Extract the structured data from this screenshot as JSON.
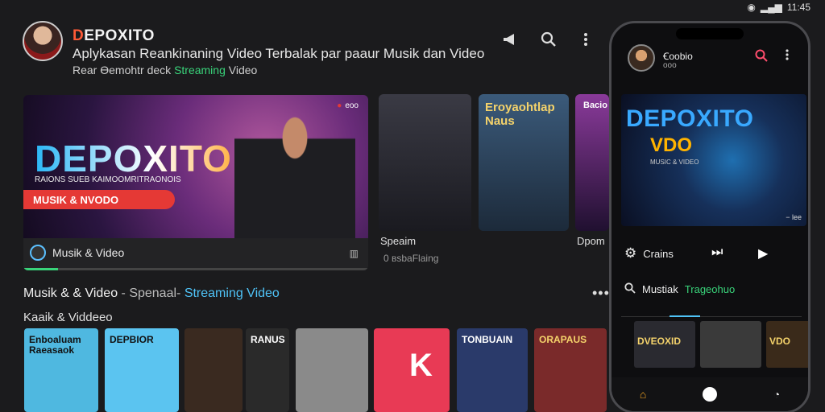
{
  "status_bar": {
    "time": "11:45",
    "signal": "▂▄▆",
    "wifi": "wifi-icon"
  },
  "header": {
    "app_name_accent": "D",
    "app_name_rest": "EPOXITO",
    "description": "Aplykasan Reankinaning Video Terbalak par paaur Musik dan Video",
    "sub_prefix": "Rear Ɵemohtr deck",
    "sub_highlight": "Streaming",
    "sub_suffix": "Video"
  },
  "hero": {
    "title": "DEPOXITO",
    "tagline": "RAIONS SUEB KAIMOOMRITRAONOIS",
    "button": "MUSIK & NVODO",
    "live_label": "eoo",
    "footer_label": "Musik & Video"
  },
  "thumbs": [
    {
      "title": "",
      "caption": "Speaim",
      "sub": "0 ʙsbaFlaing"
    },
    {
      "title": "Eroyaohtlap Naus",
      "caption": "",
      "sub": ""
    },
    {
      "title": "Bacio",
      "caption": "Dpom",
      "sub": ""
    }
  ],
  "section": {
    "title_part1": "Musik & & Video",
    "title_part2": " - Spenaal- ",
    "title_part3": "Streaming Video",
    "more": "•••",
    "subtitle": "Kaaik & Viddeeo"
  },
  "tiles": [
    {
      "label": "Enboaluam Raeasaok",
      "color": "#4fb8e0",
      "text_color": "#111"
    },
    {
      "label": "DEPBIOR",
      "color": "#5bc4f0",
      "text_color": "#111"
    },
    {
      "label": "",
      "color": "#3a2a20",
      "text_color": "#fff"
    },
    {
      "label": "RANUS",
      "color": "#2a2a2a",
      "text_color": "#fff"
    },
    {
      "label": "",
      "color": "#8a8a8a",
      "text_color": "#fff"
    },
    {
      "label": "K",
      "color": "#e83a55",
      "text_color": "#fff"
    },
    {
      "label": "TONBUAIN",
      "color": "#2a3a6a",
      "text_color": "#fff"
    },
    {
      "label": "ORAPAUS",
      "color": "#7a2a2a",
      "text_color": "#f5d36b"
    }
  ],
  "phone": {
    "profile_name": "Ꞓoobio",
    "profile_sub": "ooo",
    "banner_title": "DEPOXITO",
    "banner_vdo": "VDO",
    "banner_tag": "MUSIC & VIDEO",
    "banner_foot": "− lee",
    "settings_label": "Crains",
    "search_label": "Mustiak",
    "search_highlight": "Trageohuo",
    "tiles": [
      {
        "label": "DVEOXID",
        "color": "#2a2a30",
        "text_color": "#f5d36b"
      },
      {
        "label": "",
        "color": "#3a3a3a",
        "text_color": "#fff"
      },
      {
        "label": "VDO",
        "color": "#3a2a1a",
        "text_color": "#f5d36b"
      }
    ]
  }
}
